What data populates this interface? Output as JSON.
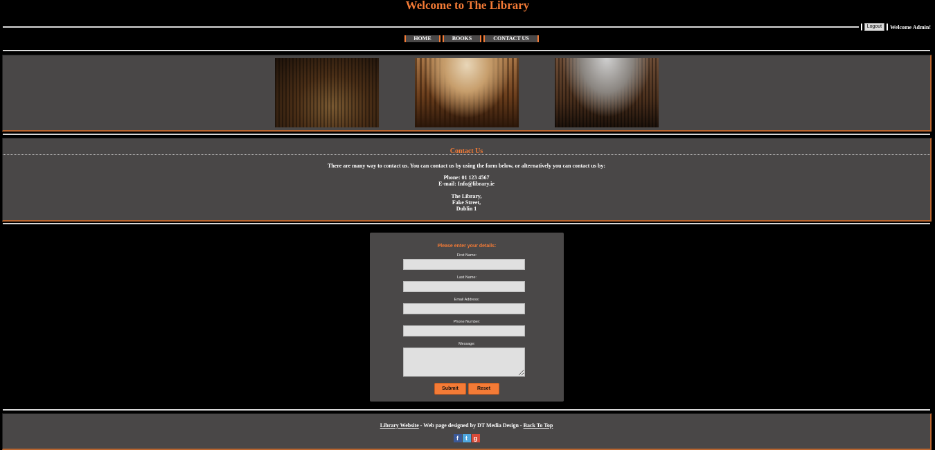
{
  "header": {
    "title": "Welcome to The Library",
    "logout_label": "Logout",
    "welcome_text": "Welcome Admin!"
  },
  "nav": {
    "items": [
      {
        "label": "HOME"
      },
      {
        "label": "BOOKS"
      },
      {
        "label": "CONTACT US"
      }
    ]
  },
  "gallery": {
    "photos": [
      "library-interior-photo",
      "baroque-library-hall-photo",
      "circular-library-photo"
    ]
  },
  "contact": {
    "heading": "Contact Us",
    "intro": "There are many way to contact us. You can contact us by using the form below, or alternatively you can contact us by:",
    "phone": "Phone: 01 123 4567",
    "email": "E-mail: Info@library.ie",
    "address": [
      "The Library,",
      "Fake Street,",
      "Dublin 1"
    ]
  },
  "form": {
    "title": "Please enter your details:",
    "fields": [
      {
        "label": "First Name:",
        "value": ""
      },
      {
        "label": "Last Name:",
        "value": ""
      },
      {
        "label": "Email Address:",
        "value": ""
      },
      {
        "label": "Phone Number:",
        "value": ""
      },
      {
        "label": "Message:",
        "value": ""
      }
    ],
    "submit_label": "Submit",
    "reset_label": "Reset"
  },
  "footer": {
    "site_link": "Library Website",
    "designed_by": " - Web page designed by DT Media Design - ",
    "back_to_top": "Back To Top",
    "social": [
      "facebook-icon",
      "twitter-icon",
      "google-plus-icon"
    ]
  },
  "colors": {
    "accent": "#f47b36",
    "panel": "#494747",
    "background": "#000000"
  }
}
